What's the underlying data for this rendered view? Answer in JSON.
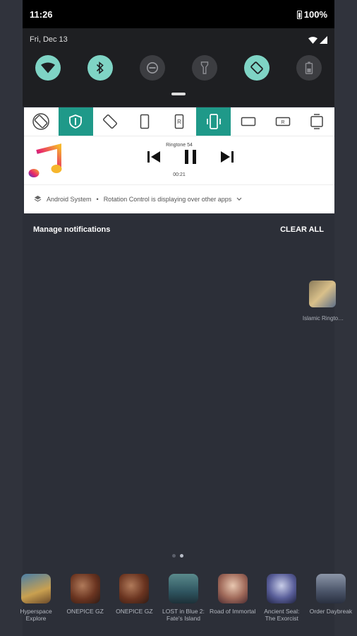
{
  "status_bar": {
    "time": "11:26",
    "battery": "100%"
  },
  "quick_settings": {
    "date": "Fri, Dec 13",
    "tiles": [
      {
        "icon": "wifi-icon",
        "state": "on"
      },
      {
        "icon": "bluetooth-icon",
        "state": "on"
      },
      {
        "icon": "dnd-icon",
        "state": "off"
      },
      {
        "icon": "flashlight-icon",
        "state": "off"
      },
      {
        "icon": "auto-rotate-icon",
        "state": "on"
      },
      {
        "icon": "battery-saver-icon",
        "state": "off"
      }
    ]
  },
  "rotation_control": {
    "buttons": [
      "auto-rotate-icon",
      "shield-icon",
      "rotate-screen-icon",
      "portrait-icon",
      "reverse-portrait-icon",
      "sensor-portrait-icon",
      "landscape-icon",
      "reverse-landscape-icon",
      "full-sensor-icon"
    ],
    "active": [
      1,
      5
    ],
    "accent": "#1f9989"
  },
  "media": {
    "title": "Ringtone 54",
    "time": "00:21"
  },
  "system_notification": {
    "app": "Android System",
    "separator": "•",
    "message": "Rotation Control is displaying over other apps"
  },
  "actions": {
    "manage": "Manage notifications",
    "clear": "CLEAR ALL"
  },
  "desktop_icon": {
    "label": "Islamic Ringto…"
  },
  "dock": [
    {
      "label": "Hyperspace Explore"
    },
    {
      "label": "ONEPICE GZ"
    },
    {
      "label": "ONEPICE GZ"
    },
    {
      "label": "LOST in Blue 2: Fate's Island"
    },
    {
      "label": "Road of Immortal"
    },
    {
      "label": "Ancient Seal: The Exorcist"
    },
    {
      "label": "Order Daybreak"
    }
  ],
  "colors": {
    "tile_on": "#7fd4c5",
    "tile_off": "#3c3d41",
    "background": "#2c2f38"
  }
}
